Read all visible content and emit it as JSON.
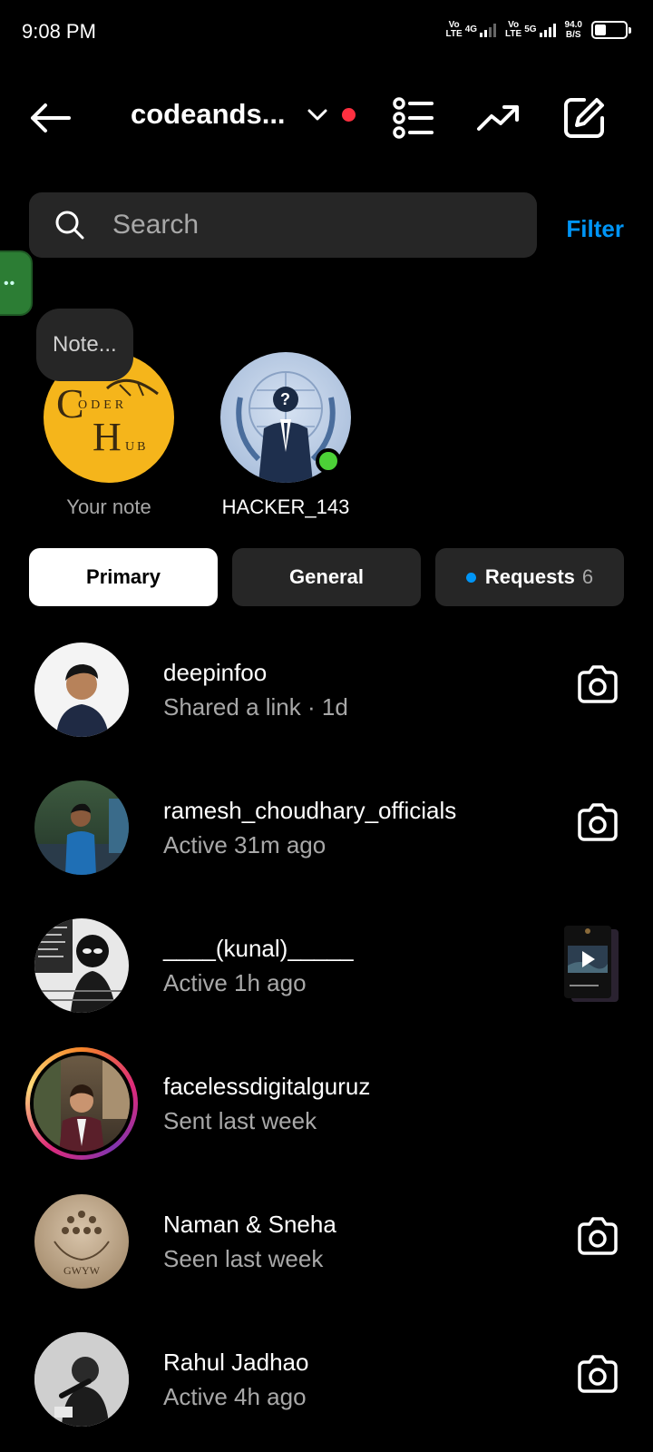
{
  "status_bar": {
    "time": "9:08 PM",
    "sim1_label_top": "Vo",
    "sim1_label_bottom": "LTE",
    "sim1_net": "4G",
    "sim2_label_top": "Vo",
    "sim2_label_bottom": "LTE",
    "sim2_net": "5G",
    "speed_value": "94.0",
    "speed_unit": "B/S",
    "battery_level": 0.25
  },
  "header": {
    "account_name": "codeands...",
    "icons": [
      "back-arrow-icon",
      "chevron-down-icon",
      "list-icon",
      "trending-icon",
      "compose-icon"
    ],
    "notification_color": "#ff3040"
  },
  "search": {
    "placeholder": "Search",
    "filter_label": "Filter"
  },
  "side_tab": {
    "label": "••"
  },
  "notes": {
    "bubble_text": "Note...",
    "items": [
      {
        "label": "Your note",
        "avatar_text_top": "ODER",
        "avatar_text_bottom": "UB",
        "avatar_letter_c": "C",
        "avatar_letter_h": "H"
      },
      {
        "label": "HACKER_143",
        "online": true
      }
    ]
  },
  "tabs": {
    "primary": "Primary",
    "general": "General",
    "requests": "Requests",
    "requests_count": "6"
  },
  "conversations": [
    {
      "name": "deepinfoo",
      "subtitle": "Shared a link · 1d",
      "action": "camera-icon"
    },
    {
      "name": "ramesh_choudhary_officials",
      "subtitle": "Active 31m ago",
      "action": "camera-icon"
    },
    {
      "name": "____(kunal)_____",
      "subtitle": "Active 1h ago",
      "action": "reel-thumbnail"
    },
    {
      "name": "facelessdigitalguruz",
      "subtitle": "Sent last week",
      "action": "none",
      "has_story": true
    },
    {
      "name": "Naman & Sneha",
      "subtitle": "Seen last week",
      "action": "camera-icon",
      "avatar_text": "GWYW"
    },
    {
      "name": "Rahul Jadhao",
      "subtitle": "Active 4h ago",
      "action": "camera-icon"
    }
  ],
  "colors": {
    "background": "#000000",
    "accent_blue": "#0095f6",
    "online_green": "#4cd137",
    "surface": "#262626",
    "secondary_text": "#a8a8a8"
  }
}
